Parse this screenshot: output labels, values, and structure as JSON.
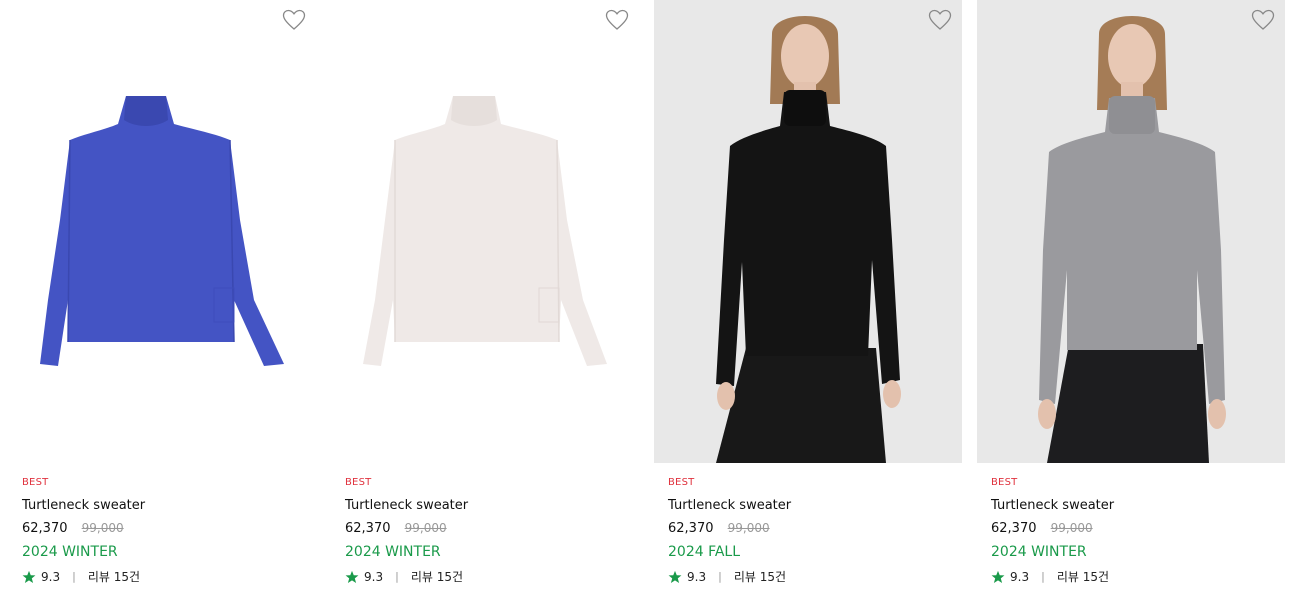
{
  "accent_colors": {
    "badge": "#e0323e",
    "season": "#1a9a4a",
    "star": "#1a9a4a",
    "strike_price": "#999999"
  },
  "products": [
    {
      "badge": "BEST",
      "name": "Turtleneck sweater",
      "sale_price": "62,370",
      "original_price": "99,000",
      "season": "2024 WINTER",
      "rating": "9.3",
      "separator": "|",
      "reviews": "리뷰 15건",
      "image": "blue turtleneck sweater flat lay",
      "wishlist_icon": "heart-outline-icon"
    },
    {
      "badge": "BEST",
      "name": "Turtleneck sweater",
      "sale_price": "62,370",
      "original_price": "99,000",
      "season": "2024 WINTER",
      "rating": "9.3",
      "separator": "|",
      "reviews": "리뷰 15건",
      "image": "off-white turtleneck sweater flat lay",
      "wishlist_icon": "heart-outline-icon"
    },
    {
      "badge": "BEST",
      "name": "Turtleneck sweater",
      "sale_price": "62,370",
      "original_price": "99,000",
      "season": "2024 FALL",
      "rating": "9.3",
      "separator": "|",
      "reviews": "리뷰 15건",
      "image": "model wearing black turtleneck sweater",
      "wishlist_icon": "heart-outline-icon"
    },
    {
      "badge": "BEST",
      "name": "Turtleneck sweater",
      "sale_price": "62,370",
      "original_price": "99,000",
      "season": "2024 WINTER",
      "rating": "9.3",
      "separator": "|",
      "reviews": "리뷰 15건",
      "image": "model wearing gray turtleneck sweater",
      "wishlist_icon": "heart-outline-icon"
    }
  ]
}
